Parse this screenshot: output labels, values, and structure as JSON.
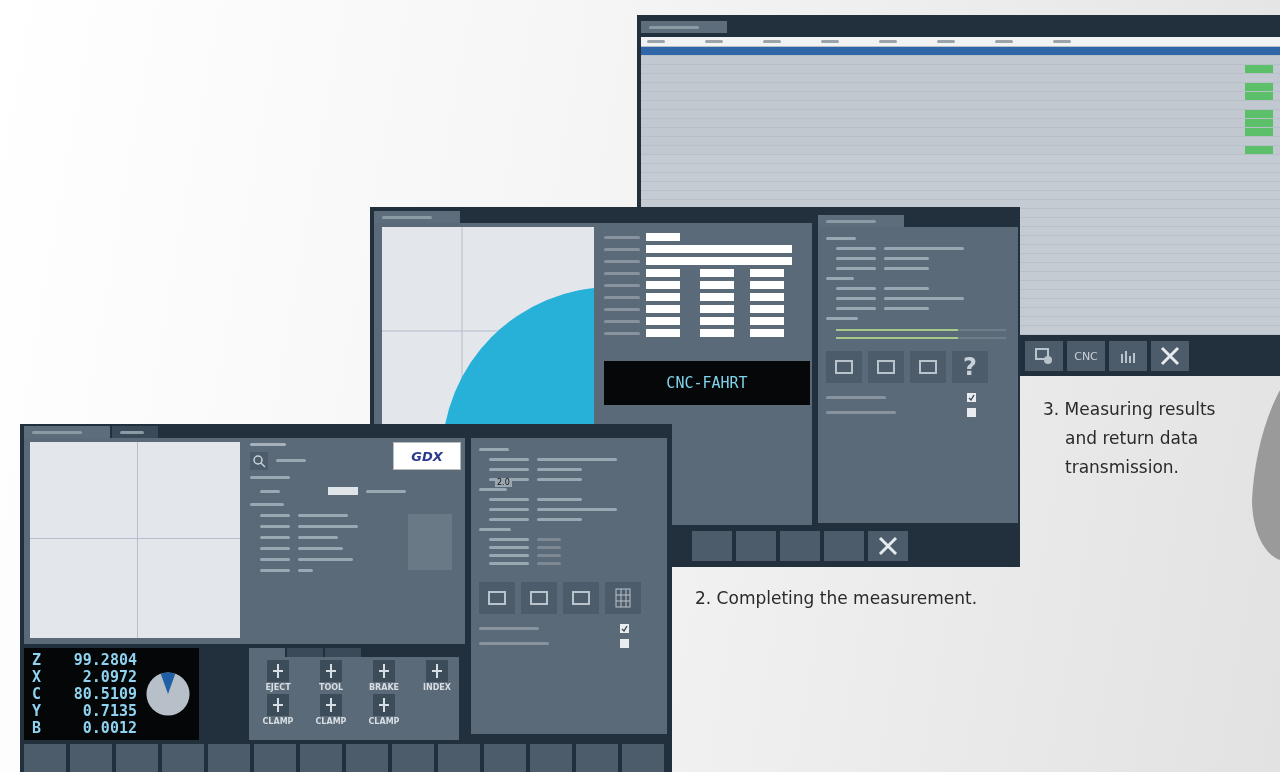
{
  "results_window": {
    "tabs": [
      {
        "selected": true
      }
    ],
    "rows": [
      {
        "selected": true,
        "passed": false
      },
      {
        "selected": false,
        "passed": false
      },
      {
        "selected": false,
        "passed": true
      },
      {
        "selected": false,
        "passed": false
      },
      {
        "selected": false,
        "passed": true
      },
      {
        "selected": false,
        "passed": true
      },
      {
        "selected": false,
        "passed": false
      },
      {
        "selected": false,
        "passed": true
      },
      {
        "selected": false,
        "passed": true
      },
      {
        "selected": false,
        "passed": true
      },
      {
        "selected": false,
        "passed": false
      },
      {
        "selected": false,
        "passed": true
      }
    ],
    "toolbar_label": "CNC"
  },
  "measure_window": {
    "tabs": [
      {
        "selected": true
      }
    ],
    "banner": "CNC-FAHRT",
    "progress": [
      {
        "level": 0.72
      },
      {
        "level": 0.72
      }
    ],
    "help_label": "?",
    "checks": [
      {
        "checked": true
      },
      {
        "checked": false
      }
    ]
  },
  "setup_window": {
    "tabs": [
      {
        "selected": true
      },
      {
        "selected": false
      }
    ],
    "logo": "GDX",
    "overlay_value": "2.0",
    "axes": [
      {
        "axis": "Z",
        "value": "99.2804"
      },
      {
        "axis": "X",
        "value": "2.0972"
      },
      {
        "axis": "C",
        "value": "80.5109"
      },
      {
        "axis": "Y",
        "value": "0.7135"
      },
      {
        "axis": "B",
        "value": "0.0012"
      }
    ],
    "panel_tabs": [
      {
        "selected": true
      },
      {
        "selected": false
      },
      {
        "selected": false
      }
    ],
    "actions": [
      {
        "label": "EJECT"
      },
      {
        "label": "TOOL"
      },
      {
        "label": "BRAKE"
      },
      {
        "label": "INDEX"
      },
      {
        "label": "CLAMP"
      },
      {
        "label": "CLAMP"
      },
      {
        "label": "CLAMP"
      }
    ],
    "checks": [
      {
        "checked": true
      },
      {
        "checked": false
      }
    ]
  },
  "captions": [
    {
      "text": "2. Completing the measurement."
    },
    {
      "text": "3. Measuring results and return data transmission."
    }
  ]
}
